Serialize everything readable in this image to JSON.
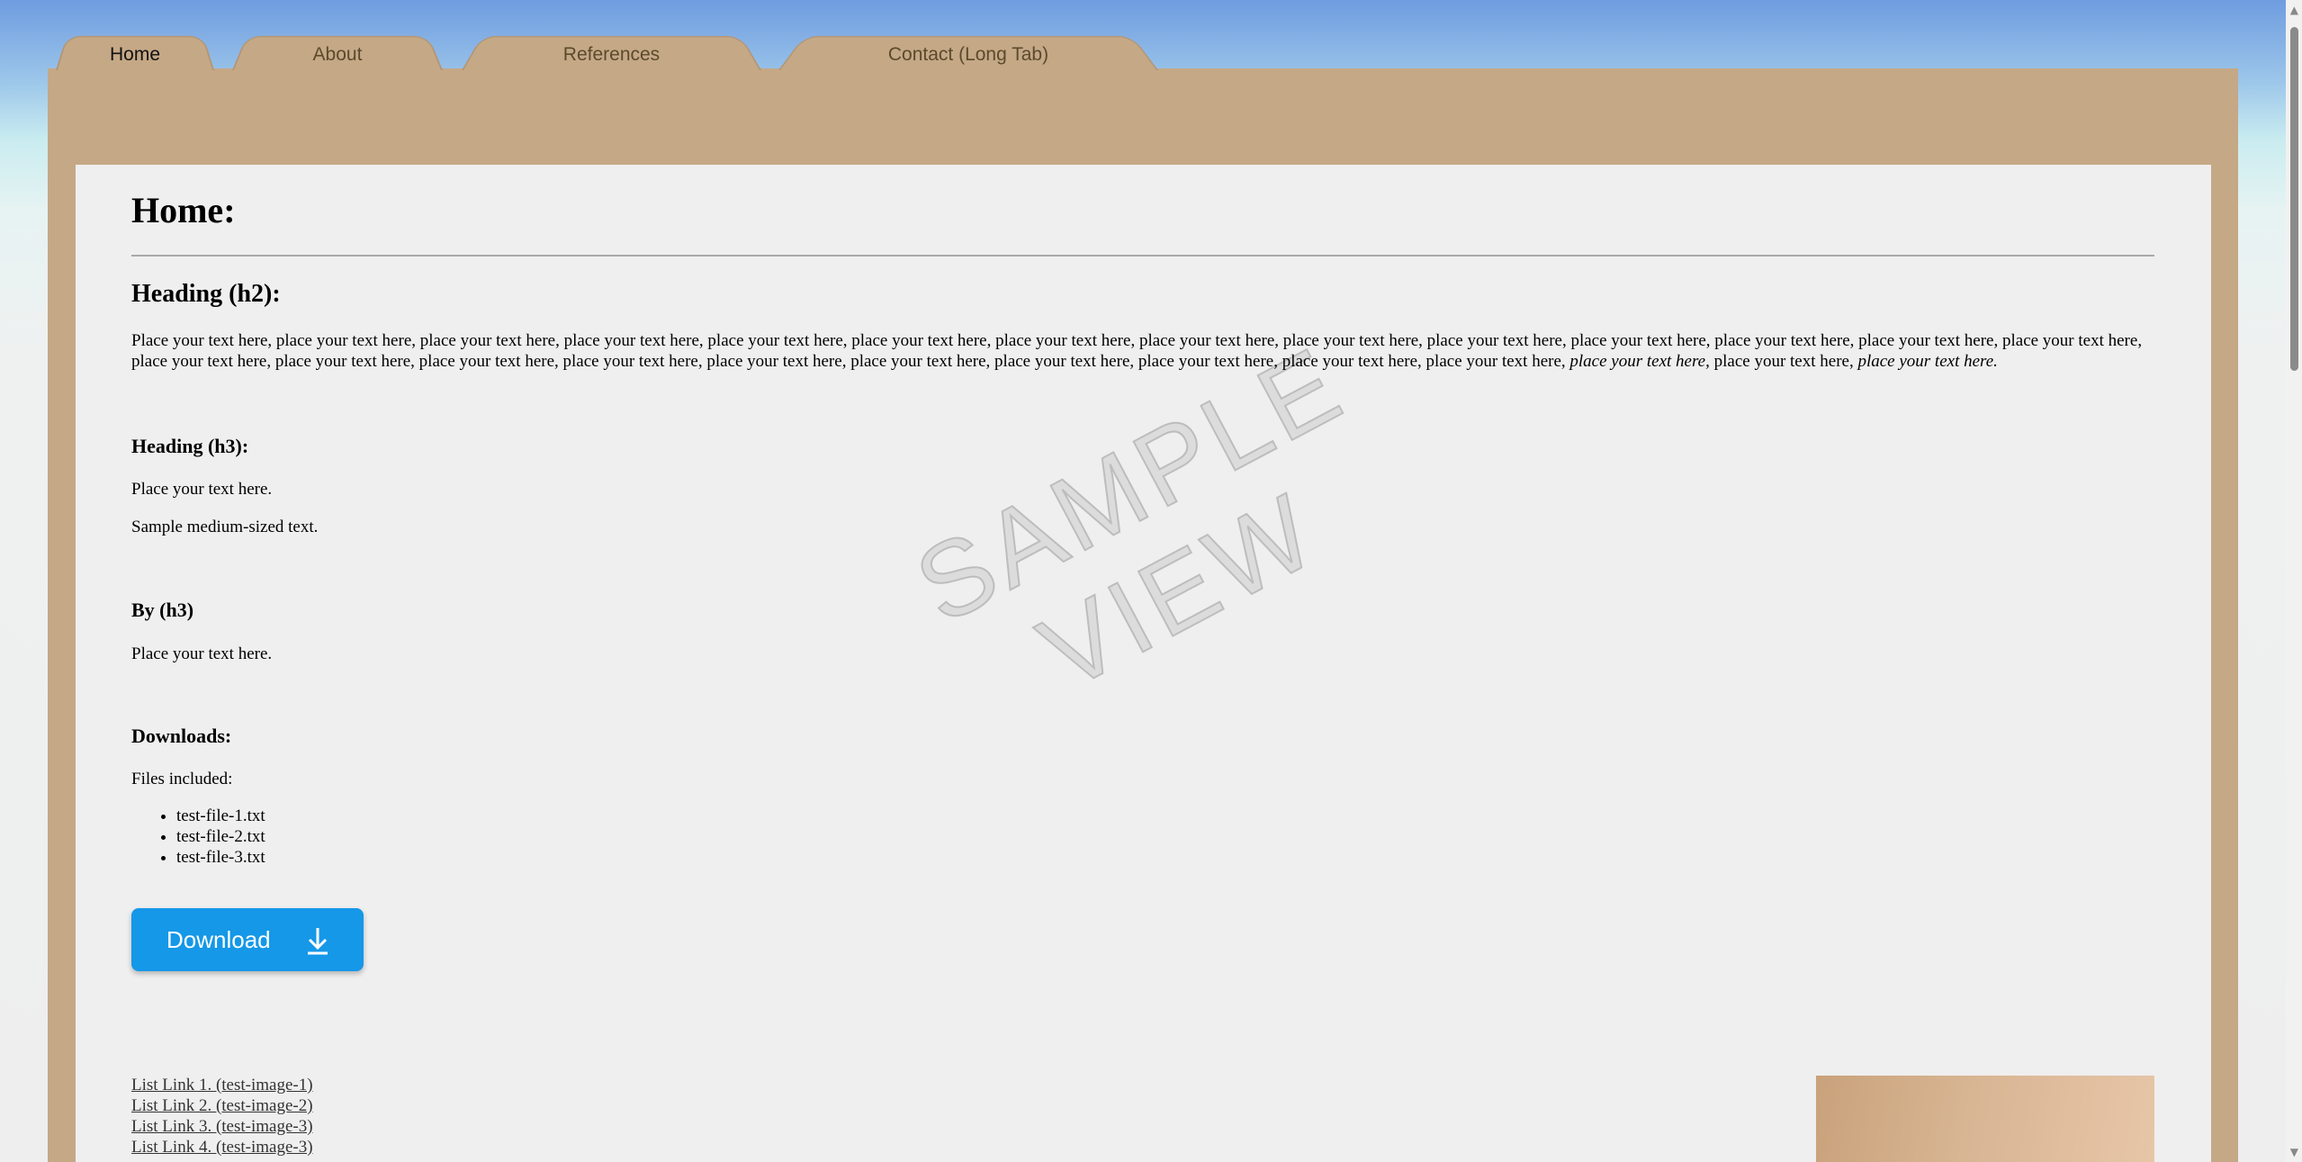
{
  "tabs": [
    {
      "label": "Home",
      "active": true
    },
    {
      "label": "About",
      "active": false
    },
    {
      "label": "References",
      "active": false
    },
    {
      "label": "Contact (Long Tab)",
      "active": false
    }
  ],
  "page": {
    "title": "Home:",
    "h2": "Heading (h2):",
    "paragraph_main": "Place your text here, place your text here, place your text here, place your text here, place your text here, place your text here, place your text here, place your text here, place your text here, place your text here, place your text here, place your text here, place your text here, place your text here, place your text here, place your text here, place your text here, place your text here, place your text here, place your text here, place your text here, place your text here, place your text here, place your text here,",
    "paragraph_italic_1": "place your text here,",
    "paragraph_mid": "place your text here,",
    "paragraph_italic_2": "place your text here.",
    "h3_heading": "Heading (h3):",
    "h3_text": "Place your text here.",
    "h3_text2": "Sample medium-sized text.",
    "by_heading": "By (h3)",
    "by_text": "Place your text here.",
    "downloads_heading": "Downloads:",
    "files_label": "Files included:",
    "files": [
      "test-file-1.txt",
      "test-file-2.txt",
      "test-file-3.txt"
    ],
    "download_button": "Download",
    "links": [
      "List Link 1. (test-image-1)",
      "List Link 2. (test-image-2)",
      "List Link 3. (test-image-3)",
      "List Link 4. (test-image-3)"
    ],
    "watermark_line1": "SAMPLE",
    "watermark_line2": "VIEW"
  },
  "colors": {
    "folder": "#c5a886",
    "sheet": "#efefef",
    "button": "#1598e8"
  },
  "icons": [
    "download-arrow-icon",
    "scroll-up-arrow-icon",
    "scroll-down-arrow-icon"
  ]
}
